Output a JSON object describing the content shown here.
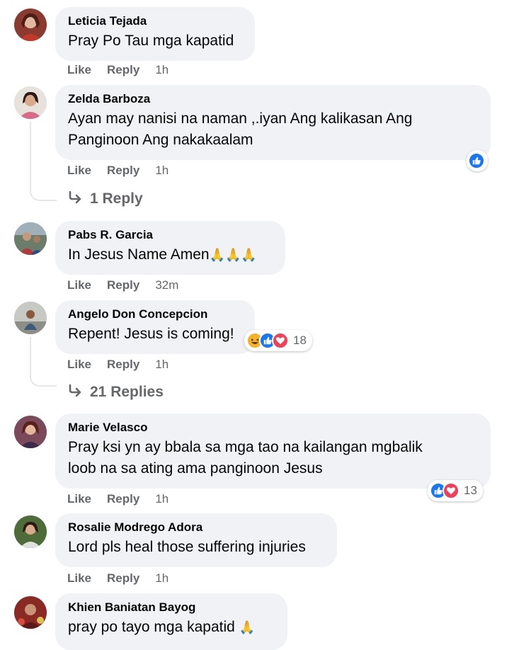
{
  "actions": {
    "like": "Like",
    "reply": "Reply"
  },
  "comments": [
    {
      "author": "Leticia Tejada",
      "text": "Pray Po Tau mga kapatid",
      "time": "1h"
    },
    {
      "author": "Zelda Barboza",
      "text_line1": "Ayan may nanisi na naman ,.iyan Ang kalikasan Ang",
      "text_line2": "Panginoon Ang nakakaalam",
      "time": "1h",
      "replies_label": "1 Reply"
    },
    {
      "author": "Pabs R. Garcia",
      "text": "In Jesus Name Amen",
      "emoji": "🙏🙏🙏",
      "time": "32m"
    },
    {
      "author": "Angelo Don Concepcion",
      "text": "Repent! Jesus is coming!",
      "time": "1h",
      "reaction_count": "18",
      "replies_label": "21 Replies"
    },
    {
      "author": "Marie Velasco",
      "text_line1": "Pray ksi yn ay bbala sa mga tao na kailangan mgbalik",
      "text_line2": "loob na sa ating ama panginoon Jesus",
      "time": "1h",
      "reaction_count": "13"
    },
    {
      "author": "Rosalie Modrego Adora",
      "text": "Lord pls heal those suffering injuries",
      "time": "1h"
    },
    {
      "author": "Khien Baniatan Bayog",
      "text": "pray po tayo mga kapatid",
      "emoji": "🙏"
    }
  ],
  "colors": {
    "bubble": "#f0f2f5",
    "meta": "#65676b",
    "like": "#1877f2",
    "love": "#f33e58",
    "haha": "#f7b125"
  }
}
